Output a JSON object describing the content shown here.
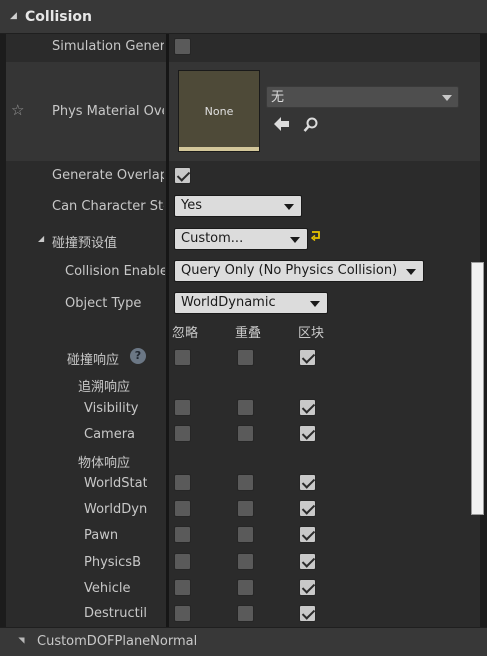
{
  "section": {
    "title": "Collision"
  },
  "rows": {
    "simulation_generates": "Simulation Genera",
    "phys_material_override": "Phys Material Ove",
    "generate_overlap": "Generate Overlap",
    "can_character_step": "Can Character Ste",
    "collision_presets": "碰撞预设值",
    "collision_enabled": "Collision Enable",
    "object_type": "Object Type",
    "collision_responses": "碰撞响应",
    "trace_responses": "追溯响应",
    "object_responses": "物体响应"
  },
  "phys_material": {
    "thumbnail_label": "None",
    "dropdown_value": "无"
  },
  "values": {
    "can_character_step": "Yes",
    "collision_presets": "Custom...",
    "collision_enabled": "Query Only (No Physics Collision)",
    "object_type": "WorldDynamic"
  },
  "response_headers": {
    "ignore": "忽略",
    "overlap": "重叠",
    "block": "区块"
  },
  "checks": {
    "simulation_generates": false,
    "generate_overlap": true
  },
  "channels": [
    {
      "label": "Visibility",
      "response": "block"
    },
    {
      "label": "Camera",
      "response": "block"
    },
    {
      "label": "WorldStat",
      "response": "block"
    },
    {
      "label": "WorldDyna",
      "response": "block"
    },
    {
      "label": "Pawn",
      "response": "block"
    },
    {
      "label": "PhysicsB",
      "response": "block"
    },
    {
      "label": "Vehicle",
      "response": "block"
    },
    {
      "label": "Destructil",
      "response": "block"
    }
  ],
  "bottom_section": {
    "title": "CustomDOFPlaneNormal"
  },
  "colors": {
    "panel": "#2b2b2b",
    "header": "#383838",
    "combo_light": "#dcdcdc",
    "reset_arrow": "#e8c300"
  },
  "icons": [
    "star-icon",
    "arrow-left-icon",
    "magnifier-icon",
    "reset-arrow-icon",
    "help-icon"
  ]
}
